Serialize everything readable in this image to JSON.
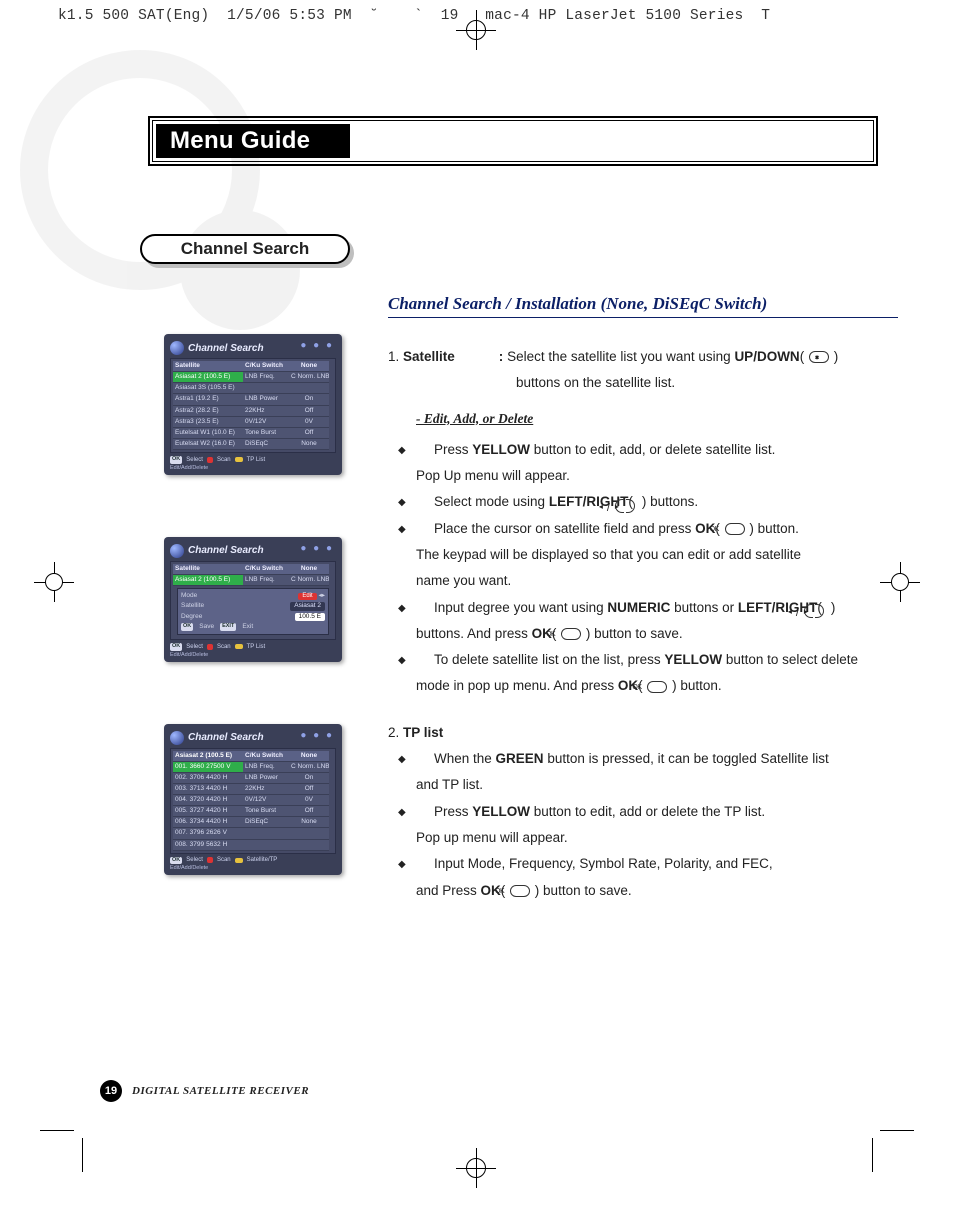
{
  "header_line": "k1.5 500 SAT(Eng)  1/5/06 5:53 PM  ˘    `  19   mac-4 HP LaserJet 5100 Series  T",
  "banner": {
    "title": "Menu Guide"
  },
  "pill": {
    "label": "Channel Search"
  },
  "section": {
    "title": "Channel Search / Installation (None, DiSEqC Switch)",
    "step1": {
      "num": "1.",
      "label": "Satellite",
      "colon": ":",
      "text_a": "Select the satellite list you want using ",
      "updown": "UP/DOWN",
      "text_b": "buttons on the satellite list."
    },
    "edit_h": "- Edit, Add, or Delete",
    "b1a": "Press ",
    "b1b": "YELLOW",
    "b1c": " button to edit, add, or delete satellite list.",
    "b1d": "Pop Up menu will appear.",
    "b2a": "Select mode using ",
    "b2b": "LEFT/RIGHT",
    "b2c": " buttons.",
    "b3a": "Place the cursor on satellite field and press ",
    "b3b": "OK",
    "b3c": " button.",
    "b3d": "The keypad will be displayed so that you can edit or add satellite",
    "b3e": "name you want.",
    "b4a": "Input degree you want using ",
    "b4b": "NUMERIC",
    "b4c": " buttons or ",
    "b4d": "LEFT/RIGHT",
    "b4e": "buttons. And press ",
    "b4f": "OK",
    "b4g": " button to save.",
    "b5a": "To delete satellite list on the list, press ",
    "b5b": "YELLOW",
    "b5c": " button to select delete",
    "b5d": "mode in pop up menu. And press ",
    "b5e": "OK",
    "b5f": " button.",
    "step2": {
      "num": "2.",
      "label": "TP list"
    },
    "c1a": "When the ",
    "c1b": "GREEN",
    "c1c": " button is pressed, it can be toggled Satellite list",
    "c1d": "and TP list.",
    "c2a": "Press ",
    "c2b": "YELLOW",
    "c2c": " button to edit, add or delete the TP list.",
    "c2d": "Pop up menu will appear.",
    "c3a": "Input Mode, Frequency, Symbol Rate, Polarity, and FEC,",
    "c3b": "and Press ",
    "c3c": "OK",
    "c3d": " button to save."
  },
  "screens": {
    "title": "Channel Search",
    "s1": {
      "header": [
        "Satellite",
        "C/Ku Switch",
        "None"
      ],
      "rows": [
        [
          "Asiasat 2 (100.5 E)",
          "LNB Freq.",
          "C Norm. LNBF"
        ],
        [
          "Asiasat 3S (105.5 E)",
          "",
          ""
        ],
        [
          "Astra1 (19.2 E)",
          "LNB Power",
          "On"
        ],
        [
          "Astra2 (28.2 E)",
          "22KHz",
          "Off"
        ],
        [
          "Astra3 (23.5 E)",
          "0V/12V",
          "0V"
        ],
        [
          "Eutelsat W1 (10.0 E)",
          "Tone Burst",
          "Off"
        ],
        [
          "Eutelsat W2 (16.0 E)",
          "DiSEqC",
          "None"
        ]
      ],
      "foot": {
        "ok": "OK",
        "select": "Select",
        "scan": "Scan",
        "tp": "TP List",
        "sub": "Edit/Add/Delete"
      }
    },
    "s2": {
      "popup": {
        "mode_l": "Mode",
        "mode_v": "Edit",
        "sat_l": "Satellite",
        "sat_v": "Asiasat 2",
        "deg_l": "Degree",
        "deg_v": "100.5 E",
        "ok": "OK",
        "save": "Save",
        "exit_l": "EXIT",
        "exit": "Exit"
      }
    },
    "s3": {
      "sat": "Asiasat 2 (100.5 E)",
      "header2": [
        "C/Ku Switch",
        "None"
      ],
      "header3": [
        "LNB Freq.",
        "C Norm. LNBF"
      ],
      "rows": [
        [
          "001.",
          "3660",
          "27500",
          "V"
        ],
        [
          "002.",
          "3706",
          "4420",
          "H"
        ],
        [
          "003.",
          "3713",
          "4420",
          "H"
        ],
        [
          "004.",
          "3720",
          "4420",
          "H"
        ],
        [
          "005.",
          "3727",
          "4420",
          "H"
        ],
        [
          "006.",
          "3734",
          "4420",
          "H"
        ],
        [
          "007.",
          "3796",
          "2626",
          "V"
        ],
        [
          "008.",
          "3799",
          "5632",
          "H"
        ]
      ],
      "params": [
        [
          "LNB Power",
          "On"
        ],
        [
          "22KHz",
          "Off"
        ],
        [
          "0V/12V",
          "0V"
        ],
        [
          "Tone Burst",
          "Off"
        ],
        [
          "DiSEqC",
          "None"
        ]
      ],
      "foot": {
        "ok": "OK",
        "select": "Select",
        "scan": "Scan",
        "tp": "Satellite/TP",
        "sub": "Edit/Add/Delete"
      }
    }
  },
  "footer": {
    "page": "19",
    "label": "DIGITAL SATELLITE RECEIVER"
  }
}
